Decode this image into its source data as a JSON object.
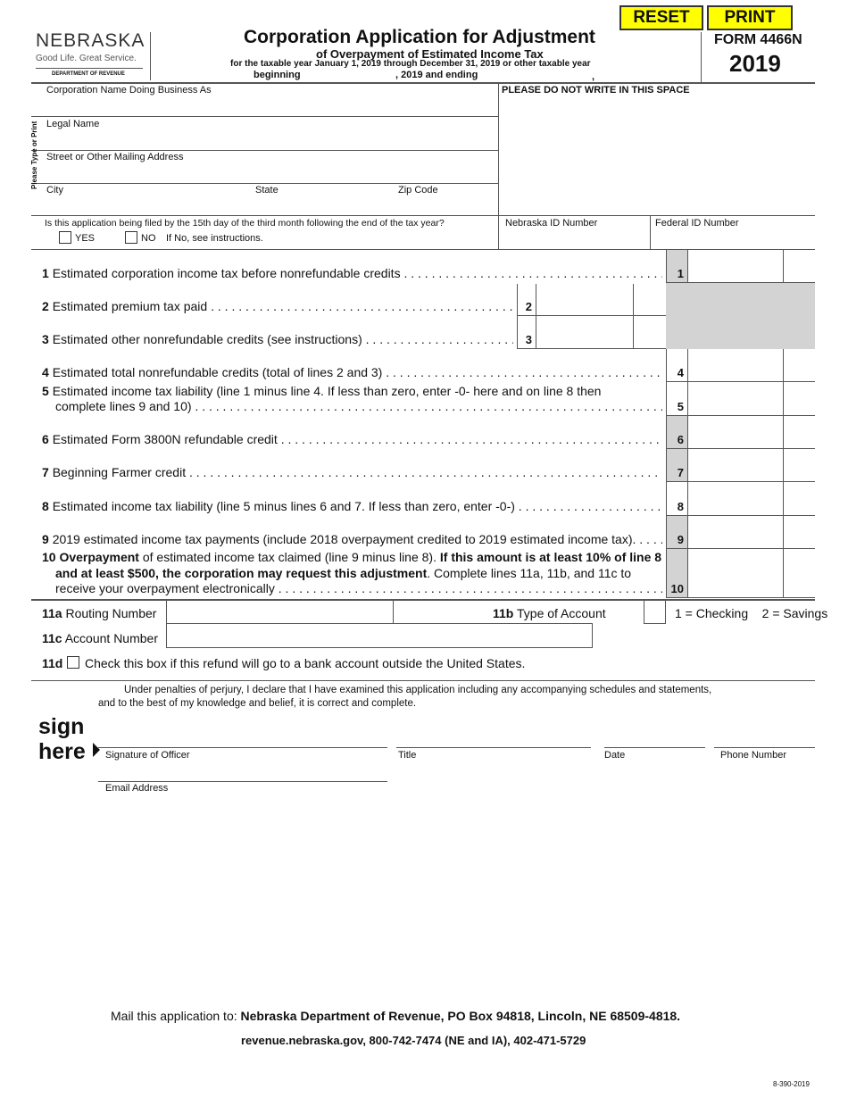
{
  "buttons": {
    "reset": "RESET",
    "print": "PRINT"
  },
  "logo": {
    "name": "NEBRASKA",
    "tagline": "Good Life. Great Service.",
    "dept": "DEPARTMENT OF REVENUE"
  },
  "header": {
    "title": "Corporation Application for Adjustment",
    "subtitle": "of Overpayment of Estimated Income Tax",
    "taxyear": "for the taxable year January 1, 2019 through December 31, 2019 or other taxable year",
    "beginning": "beginning",
    "ending": ", 2019 and ending",
    "comma": ",",
    "form": "FORM 4466N",
    "year": "2019"
  },
  "fields": {
    "dba": "Corporation Name Doing Business As",
    "office": "PLEASE DO NOT WRITE IN THIS SPACE",
    "side": "Please Type or Print",
    "legal": "Legal Name",
    "street": "Street or Other Mailing Address",
    "city": "City",
    "state": "State",
    "zip": "Zip Code",
    "question": "Is this application being filed by the 15th day of the third month following the end of the tax year?",
    "yes": "YES",
    "no": "NO",
    "no_note": "If No, see instructions.",
    "neid": "Nebraska ID Number",
    "fedid": "Federal ID Number"
  },
  "lines": [
    {
      "num": "1",
      "text": "Estimated corporation income tax before nonrefundable credits",
      "box": "1"
    },
    {
      "num": "2",
      "text": "Estimated premium tax paid",
      "box": "2"
    },
    {
      "num": "3",
      "text": "Estimated other nonrefundable credits (see instructions)",
      "box": "3"
    },
    {
      "num": "4",
      "text": "Estimated total nonrefundable credits (total of lines 2 and 3)",
      "box": "4"
    },
    {
      "num": "5",
      "text": "Estimated income tax liability (line 1 minus line 4. If less than zero, enter -0- here and on line 8 then",
      "text2": "complete lines 9 and 10)",
      "box": "5"
    },
    {
      "num": "6",
      "text": "Estimated Form 3800N refundable credit",
      "box": "6"
    },
    {
      "num": "7",
      "text": "Beginning Farmer credit",
      "box": "7"
    },
    {
      "num": "8",
      "text": "Estimated income tax liability (line 5 minus lines 6 and 7. If less than zero, enter -0-)",
      "box": "8"
    },
    {
      "num": "9",
      "text": "2019 estimated income tax payments (include 2018 overpayment credited to 2019 estimated income tax).",
      "box": "9"
    },
    {
      "num": "10",
      "bold1": "Overpayment",
      "text": " of estimated income tax claimed (line 9 minus line 8). ",
      "bold2": "If this amount is at least 10% of line 8",
      "bold3": "and at least $500, the corporation may request this adjustment",
      "text2": ". Complete lines 11a, 11b, and 11c to",
      "text3": "receive your overpayment electronically",
      "box": "10"
    }
  ],
  "bank": {
    "a_num": "11a",
    "a": "Routing Number",
    "b_num": "11b",
    "b": "Type of Account",
    "b_opts": "1 = Checking    2 = Savings",
    "c_num": "11c",
    "c": "Account Number",
    "d_num": "11d",
    "d": "Check this box if this refund will go to a bank account outside the United States."
  },
  "sign": {
    "decl1": "Under penalties of perjury, I declare that I have examined this application including any accompanying schedules and statements,",
    "decl2": "and to the best of my knowledge and belief, it is correct and complete.",
    "sign": "sign",
    "here": "here",
    "officer": "Signature of Officer",
    "title": "Title",
    "date": "Date",
    "phone": "Phone Number",
    "email": "Email Address"
  },
  "footer": {
    "mail_pre": "Mail this application to: ",
    "mail": "Nebraska Department of Revenue, PO Box 94818, Lincoln, NE 68509-4818.",
    "contact": "revenue.nebraska.gov, 800-742-7474 (NE and IA), 402-471-5729",
    "code": "8-390-2019"
  }
}
